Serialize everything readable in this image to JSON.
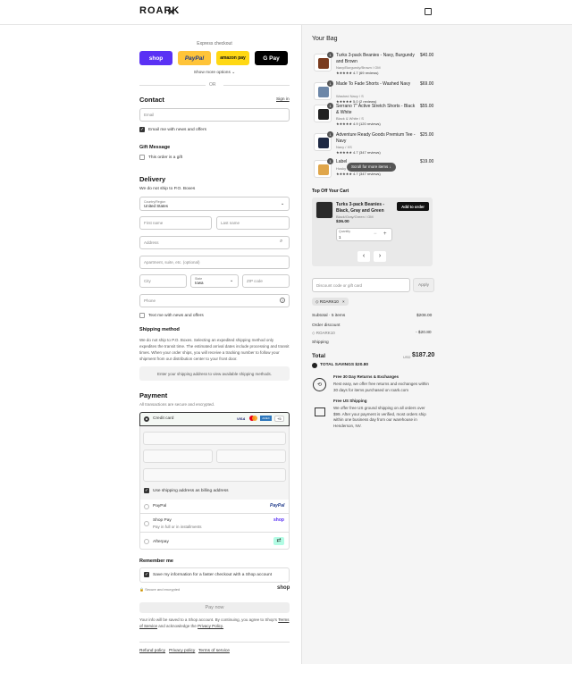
{
  "brand": "ROARK",
  "express": {
    "title": "Express checkout",
    "shop": "shop",
    "paypal": "PayPal",
    "amazon": "amazon pay",
    "gpay": "G Pay",
    "more": "Show more options ⌄",
    "or": "OR"
  },
  "contact": {
    "title": "Contact",
    "signin": "Sign in",
    "email_ph": "Email",
    "news": "Email me with news and offers"
  },
  "gift": {
    "title": "Gift Message",
    "label": "This order is a gift"
  },
  "delivery": {
    "title": "Delivery",
    "note": "We do not ship to P.O. Boxes",
    "country_label": "Country/Region",
    "country": "United States",
    "first_ph": "First name",
    "last_ph": "Last name",
    "address_ph": "Address",
    "apt_ph": "Apartment, suite, etc. (optional)",
    "city_ph": "City",
    "state_label": "State",
    "state": "Iowa",
    "zip_ph": "ZIP code",
    "phone_ph": "Phone",
    "text_news": "Text me with news and offers"
  },
  "shipping": {
    "title": "Shipping method",
    "desc": "We do not ship to P.O. Boxes. Selecting an expedited shipping method only expedites the transit time. The estimated arrival dates include processing and transit times. When your order ships, you will receive a tracking number to follow your shipment from our distribution center to your front door.",
    "placeholder": "Enter your shipping address to view available shipping methods."
  },
  "payment": {
    "title": "Payment",
    "sub": "All transactions are secure and encrypted.",
    "credit": "Credit card",
    "visa": "VISA",
    "amex": "AMEX",
    "more_cards": "+5",
    "billing": "Use shipping address as billing address",
    "paypal": "PayPal",
    "shoppay": "Shop Pay",
    "shoppay_sub": "Pay in full or in installments",
    "afterpay": "Afterpay",
    "shoppay_logo": "shop"
  },
  "remember": {
    "title": "Remember me",
    "label": "Save my information for a faster checkout with a Shop account",
    "secure": "Secure and encrypted",
    "shop": "shop"
  },
  "paynow": "Pay now",
  "legal": {
    "pre": "Your info will be saved to a Shop account. By continuing, you agree to Shop's",
    "tos": "Terms of Service",
    "mid": "and acknowledge the",
    "privacy": "Privacy Policy."
  },
  "footer": {
    "refund": "Refund policy",
    "privacy": "Privacy policy",
    "terms": "Terms of service"
  },
  "bag": {
    "title": "Your Bag",
    "items": [
      {
        "qty": "1",
        "name": "Turks 3-pack Beanies - Navy, Burgundy and Brown",
        "variant": "Navy/Burgundy/Brown / OM",
        "rating": "4.7 (69 reviews)",
        "price": "$40.00",
        "color": "#7a3b1e"
      },
      {
        "qty": "1",
        "name": "Made To Fade Shorts - Washed Navy",
        "variant": "Washed Navy / S",
        "rating": "5.0 (2 reviews)",
        "price": "$69.00",
        "color": "#6d87a8"
      },
      {
        "qty": "1",
        "name": "Serrano 7\" Active Stretch Shorts - Black & White",
        "variant": "Black & White / S",
        "rating": "4.9 (120 reviews)",
        "price": "$55.00",
        "color": "#222"
      },
      {
        "qty": "1",
        "name": "Adventure Ready Goods Premium Tee - Navy",
        "variant": "Navy / XS",
        "rating": "4.7 (347 reviews)",
        "price": "$25.00",
        "color": "#1f2a44"
      },
      {
        "qty": "1",
        "name": "Label",
        "variant": "Husky",
        "rating": "4.7 (347 reviews)",
        "price": "$19.00",
        "color": "#e0a64a"
      }
    ],
    "scroll": "Scroll for more items ↓"
  },
  "upsell": {
    "title": "Top Off Your Cart",
    "name": "Turks 3-pack Beanies - Black, Gray and Green",
    "variant": "Black/Gray/Green / OM",
    "price": "$36.00",
    "add": "Add to order",
    "qty_label": "Quantity",
    "qty": "1",
    "prev": "‹",
    "next": "›"
  },
  "discount": {
    "ph": "Discount code or gift card",
    "apply": "Apply",
    "tag": "ROARK10",
    "x": "×"
  },
  "summary": {
    "subtotal_label": "Subtotal · 5 items",
    "subtotal": "$208.00",
    "order_discount": "Order discount",
    "code": "ROARK10",
    "discount": "- $20.80",
    "shipping_label": "Shipping",
    "total_label": "Total",
    "currency": "USD",
    "total": "$187.20",
    "savings": "TOTAL SAVINGS",
    "savings_amt": "$20.80"
  },
  "perks": [
    {
      "title": "Free 30 Day Returns & Exchanges",
      "text": "Rest easy, we offer free returns and exchanges within 30 days for items purchased on roark.com"
    },
    {
      "title": "Free US Shipping",
      "text": "We offer free US ground shipping on all orders over $99. After your payment is verified, most orders ship within one business day from our warehouse in Henderson, NV."
    }
  ]
}
